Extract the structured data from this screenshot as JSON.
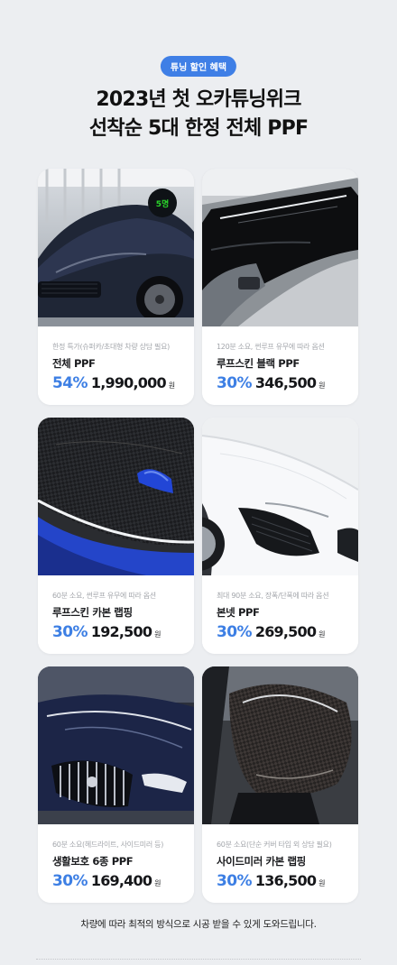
{
  "badge": "튜닝 할인 혜택",
  "headline": {
    "line1": "2023년 첫 오카튜닝위크",
    "line2": "선착순 5대 한정 전체 PPF"
  },
  "cards": [
    {
      "note": "한정 특가(슈퍼카/초대형 차량 상담 필요)",
      "name": "전체 PPF",
      "discount": "54%",
      "price": "1,990,000",
      "unit": "원",
      "tag": "5명",
      "image": "dark-blue-suv-front"
    },
    {
      "note": "120분 소요, 썬루프 유무에 따라 옵션",
      "name": "루프스킨 블랙 PPF",
      "discount": "30%",
      "price": "346,500",
      "unit": "원",
      "image": "black-roof-wrap"
    },
    {
      "note": "60분 소요, 썬루프 유무에 따라 옵션",
      "name": "루프스킨 카본 랩핑",
      "discount": "30%",
      "price": "192,500",
      "unit": "원",
      "image": "carbon-roof-blue-car"
    },
    {
      "note": "최대 90분 소요, 장폭/단폭에 따라 옵션",
      "name": "본넷 PPF",
      "discount": "30%",
      "price": "269,500",
      "unit": "원",
      "image": "white-sports-car-hood"
    },
    {
      "note": "60분 소요(헤드라이트, 사이드미러 등)",
      "name": "생활보호 6종 PPF",
      "discount": "30%",
      "price": "169,400",
      "unit": "원",
      "image": "navy-sedan-front"
    },
    {
      "note": "60분 소요(단순 커버 타입 외 상담 필요)",
      "name": "사이드미러 카본 랩핑",
      "discount": "30%",
      "price": "136,500",
      "unit": "원",
      "image": "carbon-side-mirror"
    }
  ],
  "footer": "차량에 따라 최적의 방식으로 시공 받을 수 있게 도와드립니다."
}
